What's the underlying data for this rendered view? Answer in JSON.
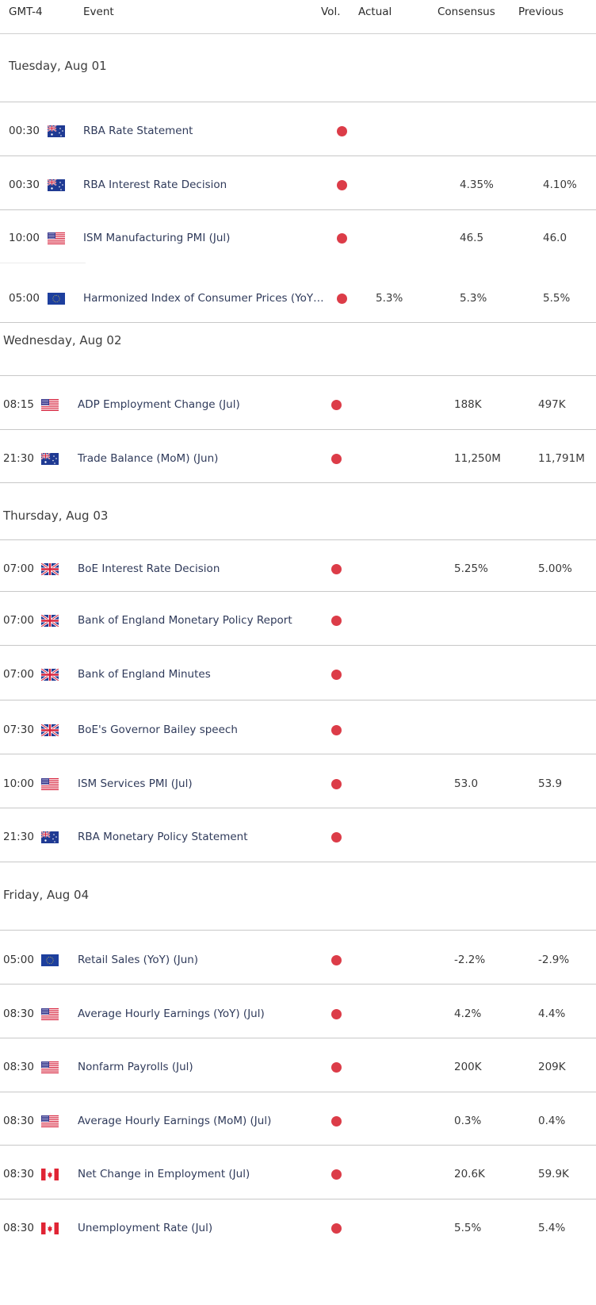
{
  "header": {
    "timezone": "GMT-4",
    "event": "Event",
    "vol": "Vol.",
    "actual": "Actual",
    "consensus": "Consensus",
    "previous": "Previous"
  },
  "colors": {
    "volatility_high": "#dc3c48",
    "event_text": "#2f3a5a"
  },
  "days": [
    {
      "date": "Tuesday, Aug 01",
      "events": [
        {
          "time": "00:30",
          "country": "AUD",
          "flag": "australia-flag-icon",
          "event": "RBA Rate Statement",
          "vol": "high",
          "actual": "",
          "consensus": "",
          "previous": ""
        },
        {
          "time": "00:30",
          "country": "AUD",
          "flag": "australia-flag-icon",
          "event": "RBA Interest Rate Decision",
          "vol": "high",
          "actual": "",
          "consensus": "4.35%",
          "previous": "4.10%"
        },
        {
          "time": "10:00",
          "country": "USD",
          "flag": "usa-flag-icon",
          "event": "ISM Manufacturing PMI (Jul)",
          "vol": "high",
          "actual": "",
          "consensus": "46.5",
          "previous": "46.0"
        },
        {
          "time": "05:00",
          "country": "EUR",
          "flag": "eu-flag-icon",
          "event": "Harmonized Index of Consumer Prices (YoY…",
          "vol": "high",
          "actual": "5.3%",
          "consensus": "5.3%",
          "previous": "5.5%"
        }
      ]
    },
    {
      "date": "Wednesday, Aug 02",
      "events": [
        {
          "time": "08:15",
          "country": "USD",
          "flag": "usa-flag-icon",
          "event": "ADP Employment Change (Jul)",
          "vol": "high",
          "actual": "",
          "consensus": "188K",
          "previous": "497K"
        },
        {
          "time": "21:30",
          "country": "AUD",
          "flag": "australia-flag-icon",
          "event": "Trade Balance (MoM) (Jun)",
          "vol": "high",
          "actual": "",
          "consensus": "11,250M",
          "previous": "11,791M"
        }
      ]
    },
    {
      "date": "Thursday, Aug 03",
      "events": [
        {
          "time": "07:00",
          "country": "GBP",
          "flag": "uk-flag-icon",
          "event": "BoE Interest Rate Decision",
          "vol": "high",
          "actual": "",
          "consensus": "5.25%",
          "previous": "5.00%"
        },
        {
          "time": "07:00",
          "country": "GBP",
          "flag": "uk-flag-icon",
          "event": "Bank of England Monetary Policy Report",
          "vol": "high",
          "actual": "",
          "consensus": "",
          "previous": ""
        },
        {
          "time": "07:00",
          "country": "GBP",
          "flag": "uk-flag-icon",
          "event": "Bank of England Minutes",
          "vol": "high",
          "actual": "",
          "consensus": "",
          "previous": ""
        },
        {
          "time": "07:30",
          "country": "GBP",
          "flag": "uk-flag-icon",
          "event": "BoE's Governor Bailey speech",
          "vol": "high",
          "actual": "",
          "consensus": "",
          "previous": ""
        },
        {
          "time": "10:00",
          "country": "USD",
          "flag": "usa-flag-icon",
          "event": "ISM Services PMI (Jul)",
          "vol": "high",
          "actual": "",
          "consensus": "53.0",
          "previous": "53.9"
        },
        {
          "time": "21:30",
          "country": "AUD",
          "flag": "australia-flag-icon",
          "event": "RBA Monetary Policy Statement",
          "vol": "high",
          "actual": "",
          "consensus": "",
          "previous": ""
        }
      ]
    },
    {
      "date": "Friday, Aug 04",
      "events": [
        {
          "time": "05:00",
          "country": "EUR",
          "flag": "eu-flag-icon",
          "event": "Retail Sales (YoY) (Jun)",
          "vol": "high",
          "actual": "",
          "consensus": "-2.2%",
          "previous": "-2.9%"
        },
        {
          "time": "08:30",
          "country": "USD",
          "flag": "usa-flag-icon",
          "event": "Average Hourly Earnings (YoY) (Jul)",
          "vol": "high",
          "actual": "",
          "consensus": "4.2%",
          "previous": "4.4%"
        },
        {
          "time": "08:30",
          "country": "USD",
          "flag": "usa-flag-icon",
          "event": "Nonfarm Payrolls (Jul)",
          "vol": "high",
          "actual": "",
          "consensus": "200K",
          "previous": "209K"
        },
        {
          "time": "08:30",
          "country": "USD",
          "flag": "usa-flag-icon",
          "event": "Average Hourly Earnings (MoM) (Jul)",
          "vol": "high",
          "actual": "",
          "consensus": "0.3%",
          "previous": "0.4%"
        },
        {
          "time": "08:30",
          "country": "CAD",
          "flag": "canada-flag-icon",
          "event": "Net Change in Employment (Jul)",
          "vol": "high",
          "actual": "",
          "consensus": "20.6K",
          "previous": "59.9K"
        },
        {
          "time": "08:30",
          "country": "CAD",
          "flag": "canada-flag-icon",
          "event": "Unemployment Rate (Jul)",
          "vol": "high",
          "actual": "",
          "consensus": "5.5%",
          "previous": "5.4%"
        }
      ]
    }
  ]
}
